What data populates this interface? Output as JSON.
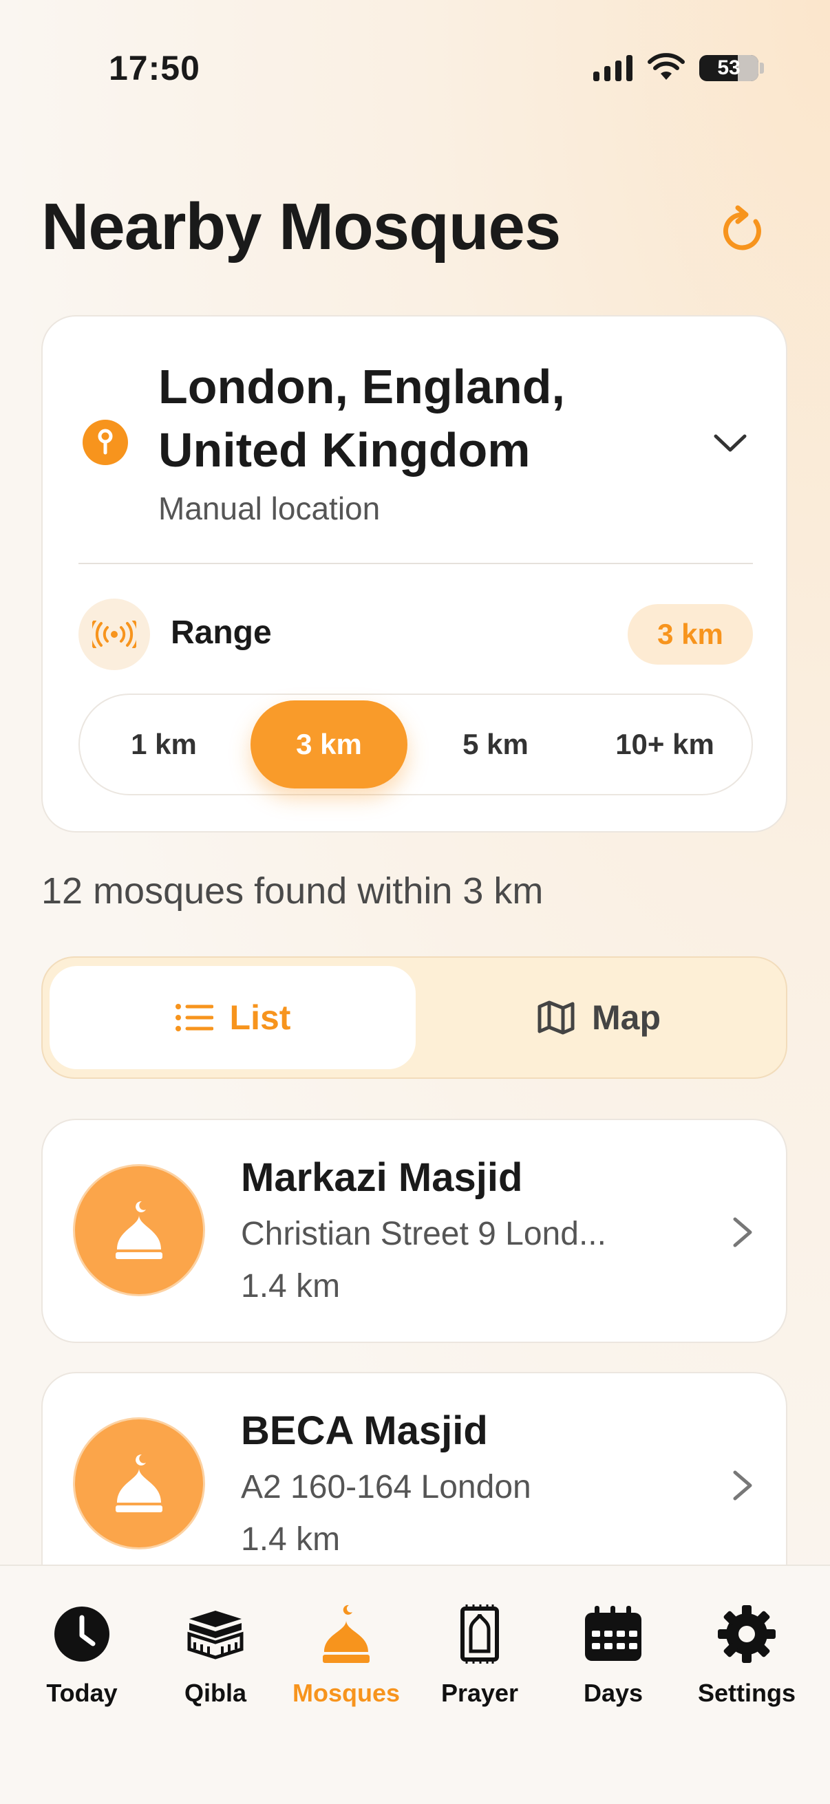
{
  "status_bar": {
    "time": "17:50",
    "battery": "53"
  },
  "header": {
    "title": "Nearby Mosques",
    "refresh_icon": "refresh-icon"
  },
  "location": {
    "name": "London, England, United Kingdom",
    "subtitle": "Manual location",
    "range_label": "Range",
    "range_value": "3 km",
    "options": [
      "1 km",
      "3 km",
      "5 km",
      "10+ km"
    ],
    "selected": "3 km"
  },
  "results": {
    "summary": "12 mosques found within 3 km"
  },
  "view_toggle": {
    "list": "List",
    "map": "Map",
    "selected": "List"
  },
  "mosques": [
    {
      "name": "Markazi Masjid",
      "address": "Christian Street 9 Lond...",
      "distance": "1.4 km"
    },
    {
      "name": "BECA Masjid",
      "address": "A2 160-164 London",
      "distance": "1.4 km"
    }
  ],
  "tabs": [
    {
      "label": "Today",
      "icon": "clock-icon"
    },
    {
      "label": "Qibla",
      "icon": "kaaba-icon"
    },
    {
      "label": "Mosques",
      "icon": "mosque-icon"
    },
    {
      "label": "Prayer",
      "icon": "prayer-mat-icon"
    },
    {
      "label": "Days",
      "icon": "calendar-icon"
    },
    {
      "label": "Settings",
      "icon": "gear-icon"
    }
  ],
  "active_tab": "Mosques",
  "colors": {
    "accent": "#f7941d",
    "accent_light": "#fdebd3",
    "background": "#faf6f1"
  }
}
